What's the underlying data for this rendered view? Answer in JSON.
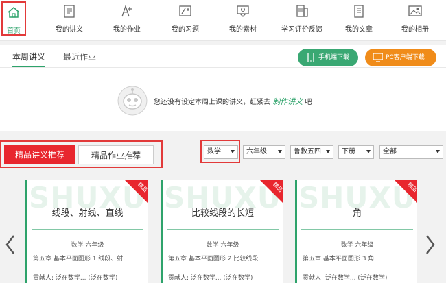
{
  "nav": {
    "items": [
      {
        "label": "首页",
        "icon": "home-icon"
      },
      {
        "label": "我的讲义",
        "icon": "lecture-icon"
      },
      {
        "label": "我的作业",
        "icon": "homework-icon"
      },
      {
        "label": "我的习题",
        "icon": "exercise-icon"
      },
      {
        "label": "我的素材",
        "icon": "material-icon"
      },
      {
        "label": "学习评价反馈",
        "icon": "feedback-icon"
      },
      {
        "label": "我的文章",
        "icon": "article-icon"
      },
      {
        "label": "我的相册",
        "icon": "album-icon"
      }
    ]
  },
  "panel": {
    "tabs": [
      "本周讲义",
      "最近作业"
    ],
    "download_mobile": "手机端下载",
    "download_pc": "PC客户端下载",
    "empty_message": "您还没有设定本周上课的讲义，赶紧去",
    "empty_link": "制作讲义",
    "empty_suffix": "吧"
  },
  "recommend": {
    "tab_active": "精品讲义推荐",
    "tab_inactive": "精品作业推荐",
    "filters": [
      "数学",
      "六年级",
      "鲁教五四",
      "下册",
      "全部"
    ]
  },
  "cards": [
    {
      "title": "线段、射线、直线",
      "subject": "数学 六年级",
      "chapter": "第五章 基本平面图形 1 线段、射...",
      "contributor": "贡献人: 泛在数学... (泛在数学)",
      "badge": "精品",
      "watermark": "SHUXUE"
    },
    {
      "title": "比较线段的长短",
      "subject": "数学 六年级",
      "chapter": "第五章 基本平面图形 2 比较线段...",
      "contributor": "贡献人: 泛在数学... (泛在数学)",
      "badge": "精品",
      "watermark": "SHUXUE"
    },
    {
      "title": "角",
      "subject": "数学 六年级",
      "chapter": "第五章 基本平面图形 3 角",
      "contributor": "贡献人: 泛在数学... (泛在数学)",
      "badge": "精品",
      "watermark": "SHUXUE"
    }
  ],
  "colors": {
    "accent": "#2ea36b",
    "red": "#e8262e",
    "orange": "#f08c1a"
  }
}
